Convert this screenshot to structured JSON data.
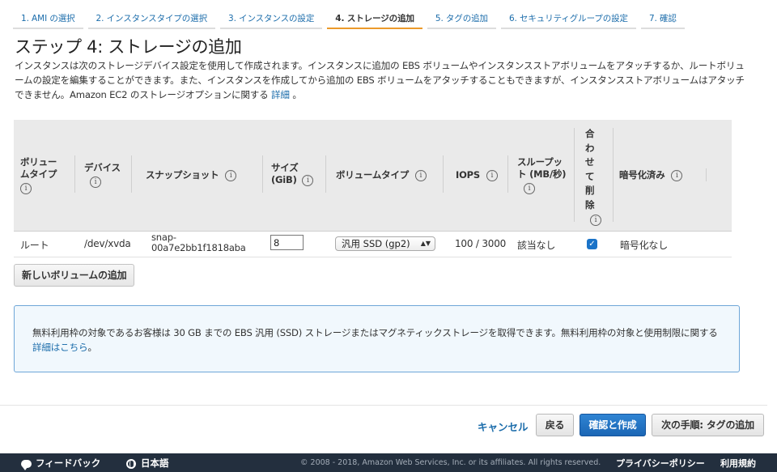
{
  "wizard_tabs": [
    {
      "label": "1. AMI の選択",
      "active": false
    },
    {
      "label": "2. インスタンスタイプの選択",
      "active": false
    },
    {
      "label": "3. インスタンスの設定",
      "active": false
    },
    {
      "label": "4. ストレージの追加",
      "active": true
    },
    {
      "label": "5. タグの追加",
      "active": false
    },
    {
      "label": "6. セキュリティグループの設定",
      "active": false
    },
    {
      "label": "7. 確認",
      "active": false
    }
  ],
  "page": {
    "title": "ステップ 4: ストレージの追加",
    "description": "インスタンスは次のストレージデバイス設定を使用して作成されます。インスタンスに追加の EBS ボリュームやインスタンスストアボリュームをアタッチするか、ルートボリュームの設定を編集することができます。また、インスタンスを作成してから追加の EBS ボリュームをアタッチすることもできますが、インスタンスストアボリュームはアタッチできません。Amazon EC2 のストレージオプションに関する",
    "description_link": "詳細",
    "description_end": "。"
  },
  "table": {
    "headers": {
      "volume_type_l1": "ボリュー",
      "volume_type_l2": "ムタイプ",
      "device": "デバイス",
      "snapshot": "スナップショット",
      "size_l1": "サイズ",
      "size_l2": "(GiB)",
      "ebs_type": "ボリュームタイプ",
      "iops": "IOPS",
      "throughput_l1": "スループッ",
      "throughput_l2": "ト (MB/秒)",
      "delete_chars": [
        "合",
        "わ",
        "せ",
        "て",
        "削",
        "除"
      ],
      "encrypted": "暗号化済み"
    },
    "info_icon_char": "i",
    "rows": [
      {
        "volume_type": "ルート",
        "device": "/dev/xvda",
        "snapshot_l1": "snap-",
        "snapshot_l2": "00a7e2bb1f1818aba",
        "size": "8",
        "ebs_type": "汎用 SSD (gp2)",
        "iops": "100 / 3000",
        "throughput": "該当なし",
        "delete_on_termination": true,
        "checkbox_char": "✓",
        "encrypted": "暗号化なし"
      }
    ],
    "select_arrow": "▲▼"
  },
  "buttons": {
    "add_volume": "新しいボリュームの追加",
    "cancel": "キャンセル",
    "back": "戻る",
    "review_launch": "確認と作成",
    "next": "次の手順: タグの追加"
  },
  "notice": {
    "text": "無料利用枠の対象であるお客様は 30 GB までの EBS 汎用 (SSD) ストレージまたはマグネティックストレージを取得できます。無料利用枠の対象と使用制限に関する",
    "link": "詳細はこちら",
    "end": "。"
  },
  "footer": {
    "feedback": "フィードバック",
    "language": "日本語",
    "copyright": "© 2008 - 2018, Amazon Web Services, Inc. or its affiliates. All rights reserved.",
    "privacy": "プライバシーポリシー",
    "terms": "利用規約"
  },
  "colors": {
    "link": "#1c6dab",
    "active_tab_underline": "#ec9a2b",
    "primary_button": "#1b66b5",
    "footer_bg": "#232f3e",
    "notice_border": "#6ea6d8"
  }
}
